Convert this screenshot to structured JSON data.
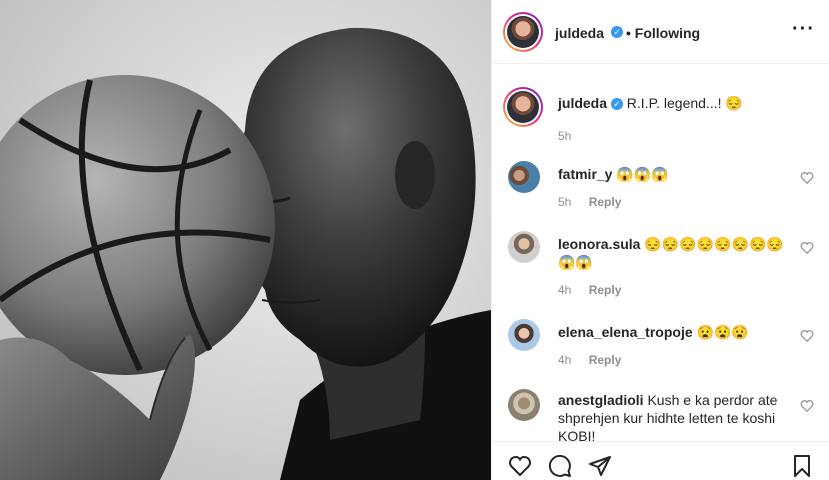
{
  "post": {
    "author": "juldeda",
    "follow_status": "• Following",
    "more_icon": "more-horizontal-icon",
    "caption": {
      "username": "juldeda",
      "text": "R.I.P. legend...! 😔",
      "time": "5h"
    }
  },
  "comments": [
    {
      "username": "fatmir_y",
      "text": "😱😱😱",
      "time": "5h",
      "reply": "Reply"
    },
    {
      "username": "leonora.sula",
      "text": "😔😔😔😔😔😔😔😔😱😱",
      "time": "4h",
      "reply": "Reply"
    },
    {
      "username": "elena_elena_tropoje",
      "text": "😧😧😧",
      "time": "4h",
      "reply": "Reply"
    },
    {
      "username": "anestgladioli",
      "text": "Kush e ka perdor ate shprehjen kur hidhte letten te koshi KOBI!",
      "time": "",
      "reply": ""
    }
  ],
  "actions": {
    "like_icon": "heart-icon",
    "comment_icon": "comment-icon",
    "share_icon": "share-icon",
    "save_icon": "bookmark-icon"
  },
  "colors": {
    "verified": "#3897f0",
    "border": "#efefef",
    "muted": "#8e8e8e"
  }
}
